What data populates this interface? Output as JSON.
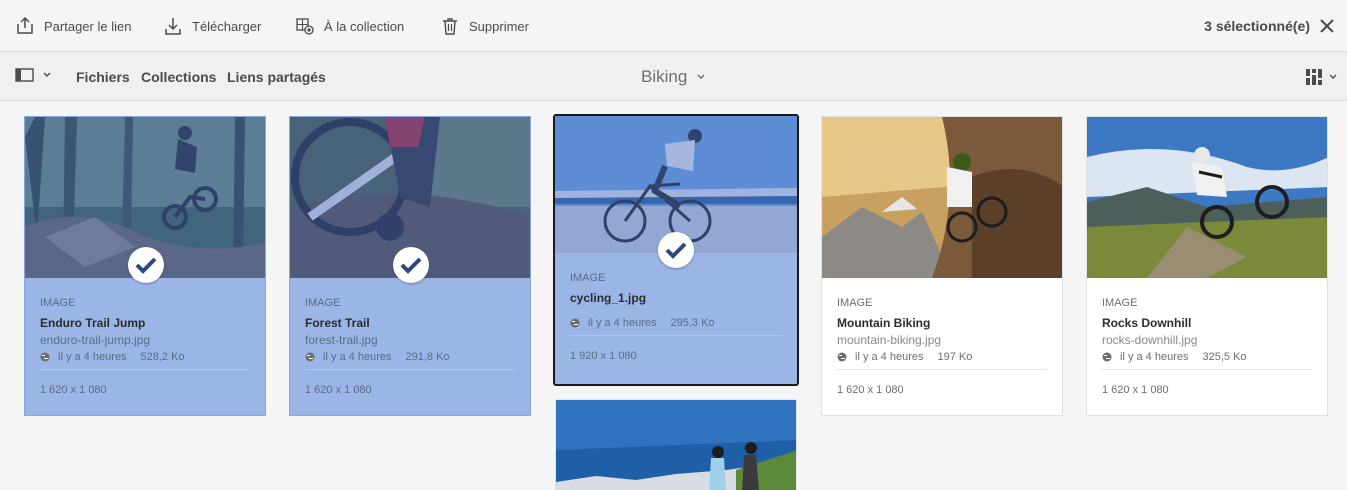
{
  "actionbar": {
    "share_label": "Partager le lien",
    "download_label": "Télécharger",
    "collection_label": "À la collection",
    "delete_label": "Supprimer",
    "selection_count": "3 sélectionné(e)"
  },
  "nav": {
    "files_label": "Fichiers",
    "collections_label": "Collections",
    "shared_links_label": "Liens partagés",
    "folder_title": "Biking"
  },
  "cards": [
    {
      "type": "IMAGE",
      "title": "Enduro Trail Jump",
      "filename": "enduro-trail-jump.jpg",
      "age": "il y a 4 heures",
      "size": "528,2 Ko",
      "dimensions": "1 620 x 1 080",
      "selected": true
    },
    {
      "type": "IMAGE",
      "title": "Forest Trail",
      "filename": "forest-trail.jpg",
      "age": "il y a 4 heures",
      "size": "291,8 Ko",
      "dimensions": "1 620 x 1 080",
      "selected": true
    },
    {
      "type": "IMAGE",
      "title": "cycling_1.jpg",
      "age": "il y a 4 heures",
      "size": "295,3 Ko",
      "dimensions": "1 920 x 1 080",
      "selected": true
    },
    {
      "type": "IMAGE",
      "title": "Mountain Biking",
      "filename": "mountain-biking.jpg",
      "age": "il y a 4 heures",
      "size": "197 Ko",
      "dimensions": "1 620 x 1 080",
      "selected": false
    },
    {
      "type": "IMAGE",
      "title": "Rocks Downhill",
      "filename": "rocks-downhill.jpg",
      "age": "il y a 4 heures",
      "size": "325,5 Ko",
      "dimensions": "1 620 x 1 080",
      "selected": false
    }
  ],
  "icons": {
    "share": "share-icon",
    "download": "download-icon",
    "collection": "add-to-collection-icon",
    "delete": "trash-icon",
    "close": "close-icon",
    "rail": "rail-toggle-icon",
    "chevron": "chevron-down-icon",
    "view": "card-view-icon",
    "globe": "globe-icon",
    "check": "checkmark-icon"
  },
  "colors": {
    "selected_card": "#9ab5e6",
    "accent": "#2c4a80"
  }
}
